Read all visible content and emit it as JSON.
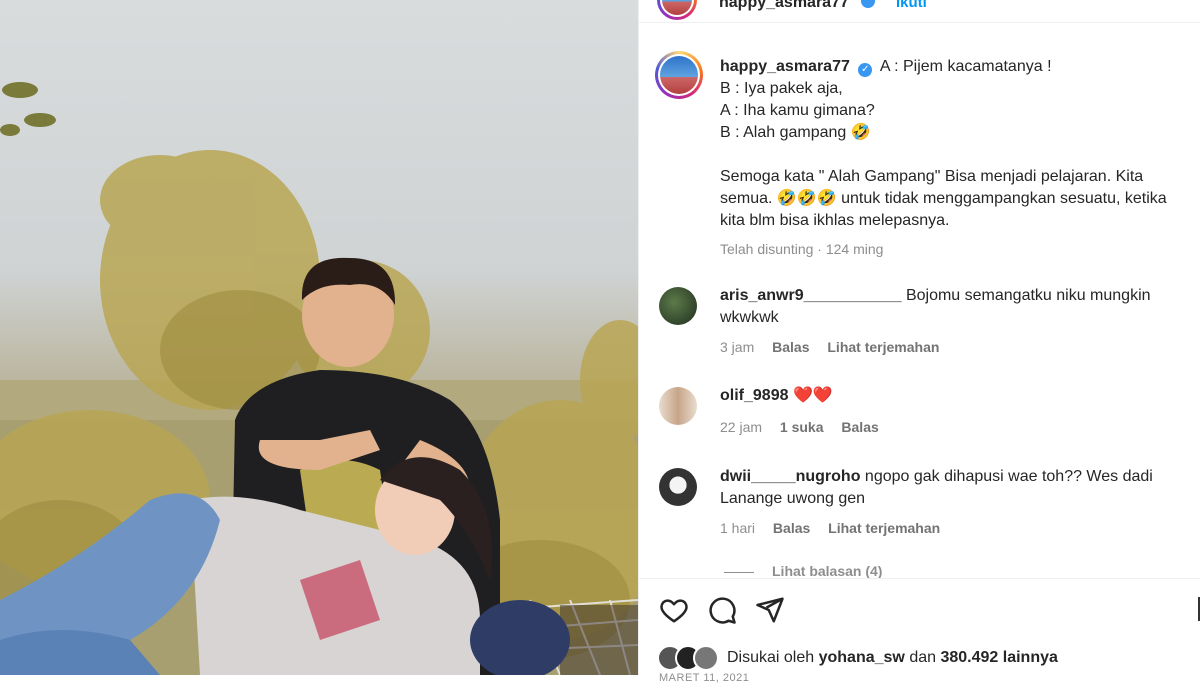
{
  "photo": {
    "alt": "photo-post"
  },
  "header": {
    "username": "happy_asmara77",
    "follow_label": "Ikuti"
  },
  "caption": {
    "username": "happy_asmara77",
    "lines": [
      "A : Pijem kacamatanya !",
      "B : Iya pakek aja,",
      "A : Iha kamu gimana?",
      "B : Alah gampang 🤣"
    ],
    "paragraph": "Semoga kata \" Alah Gampang\" Bisa menjadi pelajaran. Kita semua. 🤣🤣🤣 untuk tidak menggampangkan sesuatu, ketika kita blm bisa ikhlas melepasnya.",
    "meta": "Telah disunting · 124 ming"
  },
  "comments": [
    {
      "username": "aris_anwr9___________",
      "text": "Bojomu semangatku niku mungkin wkwkwk",
      "time": "3 jam",
      "reply": "Balas",
      "translate": "Lihat terjemahan"
    },
    {
      "username": "olif_9898",
      "text": "❤️❤️",
      "time": "22 jam",
      "likes": "1 suka",
      "reply": "Balas"
    },
    {
      "username": "dwii_____nugroho",
      "text": "ngopo gak dihapusi wae toh?? Wes dadi Lanange uwong gen",
      "time": "1 hari",
      "reply": "Balas",
      "translate": "Lihat terjemahan"
    }
  ],
  "view_replies": "Lihat balasan (4)",
  "likes": {
    "prefix": "Disukai oleh",
    "user": "yohana_sw",
    "middle": "dan",
    "count": "380.492 lainnya"
  },
  "date": "MARET 11, 2021",
  "colors": {
    "link_blue": "#0095f6",
    "verified": "#3897f0",
    "muted": "#8e8e8e"
  },
  "icons": [
    "heart-icon",
    "comment-icon",
    "share-icon",
    "verified-icon"
  ]
}
